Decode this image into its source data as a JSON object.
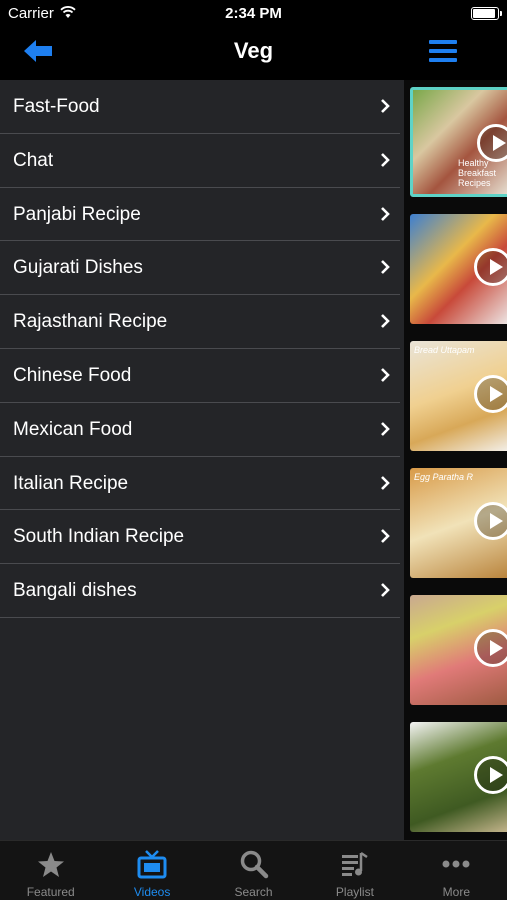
{
  "status_bar": {
    "carrier": "Carrier",
    "time": "2:34 PM",
    "battery_level": 1.0
  },
  "nav": {
    "title": "Veg",
    "back_icon": "back-arrow-icon",
    "menu_icon": "hamburger-menu-icon"
  },
  "categories": [
    {
      "label": "Fast-Food"
    },
    {
      "label": "Chat"
    },
    {
      "label": "Panjabi Recipe"
    },
    {
      "label": "Gujarati Dishes"
    },
    {
      "label": "Rajasthani Recipe"
    },
    {
      "label": "Chinese Food"
    },
    {
      "label": "Mexican Food"
    },
    {
      "label": "Italian Recipe"
    },
    {
      "label": "South Indian Recipe"
    },
    {
      "label": "Bangali dishes"
    }
  ],
  "thumbnails": [
    {
      "caption": "Healthy Breakfast Recipes",
      "selected": true
    },
    {
      "caption": ""
    },
    {
      "caption": "Bread Uttapam"
    },
    {
      "caption": "Egg Paratha R"
    },
    {
      "caption": ""
    },
    {
      "caption": ""
    }
  ],
  "tabs": [
    {
      "label": "Featured",
      "icon": "star-icon",
      "active": false
    },
    {
      "label": "Videos",
      "icon": "tv-icon",
      "active": true
    },
    {
      "label": "Search",
      "icon": "search-icon",
      "active": false
    },
    {
      "label": "Playlist",
      "icon": "playlist-icon",
      "active": false
    },
    {
      "label": "More",
      "icon": "more-dots-icon",
      "active": false
    }
  ],
  "colors": {
    "accent": "#1e8cf0",
    "list_bg": "#242528",
    "selected_border": "#5fd3c7",
    "inactive_tab": "#8a8a8a"
  }
}
